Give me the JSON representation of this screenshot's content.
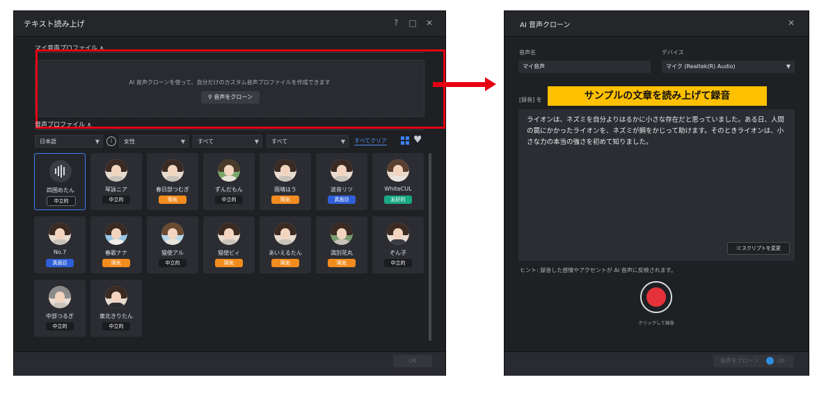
{
  "left": {
    "title": "テキスト読み上げ",
    "my_profile": {
      "header": "マイ音声プロファイル ∧",
      "description": "AI 音声クローンを使って、自分だけのカスタム音声プロファイルを作成できます",
      "clone_button": "音声をクローン",
      "clone_icon": "voice-clone-icon"
    },
    "voice_profile_header": "音声プロファイル ∧",
    "filters": {
      "language": "日本語",
      "gender": "女性",
      "all1": "すべて",
      "all2": "すべて",
      "clear_all": "すべてクリア"
    },
    "cards": [
      {
        "name": "四国めたん",
        "badge": "中立的",
        "badge_type": "neutral"
      },
      {
        "name": "琴詠ニア",
        "badge": "中立的",
        "badge_type": "neutral"
      },
      {
        "name": "春日部つむぎ",
        "badge": "陽気",
        "badge_type": "yoki"
      },
      {
        "name": "ずんだもん",
        "badge": "中立的",
        "badge_type": "neutral"
      },
      {
        "name": "雨晴はう",
        "badge": "陽気",
        "badge_type": "yoki"
      },
      {
        "name": "波音リツ",
        "badge": "真面目",
        "badge_type": "majime"
      },
      {
        "name": "WhiteCUL",
        "badge": "友好的",
        "badge_type": "friendly"
      },
      {
        "name": "No.7",
        "badge": "真面目",
        "badge_type": "majime"
      },
      {
        "name": "春歌ナナ",
        "badge": "陽気",
        "badge_type": "yoki"
      },
      {
        "name": "猫使アル",
        "badge": "中立的",
        "badge_type": "neutral"
      },
      {
        "name": "猫使ビィ",
        "badge": "陽気",
        "badge_type": "yoki"
      },
      {
        "name": "あいえるたん",
        "badge": "陽気",
        "badge_type": "yoki"
      },
      {
        "name": "満別花丸",
        "badge": "陽気",
        "badge_type": "yoki"
      },
      {
        "name": "ぞん子",
        "badge": "中立的",
        "badge_type": "neutral"
      },
      {
        "name": "中部つるぎ",
        "badge": "中立的",
        "badge_type": "neutral"
      },
      {
        "name": "東北きりたん",
        "badge": "中立的",
        "badge_type": "neutral"
      }
    ],
    "ok_button": "OK"
  },
  "right": {
    "title": "AI 音声クローン",
    "voice_name_label": "音声名",
    "voice_name_value": "マイ音声",
    "device_label": "デバイス",
    "device_value": "マイク (Realtek(R) Audio)",
    "script_label": "[録音] を",
    "overlay_label": "サンプルの文章を読み上げて録音",
    "script_text": "ライオンは、ネズミを自分よりはるかに小さな存在だと思っていました。ある日、人間の罠にかかったライオンを、ネズミが綱をかじって助けます。そのときライオンは、小さな力の本当の強さを初めて知りました。",
    "change_script": "スクリプトを変更",
    "hint": "ヒント: 録音した感情やアクセントが AI 音声に反映されます。",
    "record_label": "クリックして録音",
    "clone_submit": "音声をクローン",
    "credits": "-20"
  },
  "colors": {
    "highlight": "#e60012",
    "overlay_yellow": "#ffc000",
    "record_red": "#e5323a",
    "accent_blue": "#3b82f6"
  }
}
